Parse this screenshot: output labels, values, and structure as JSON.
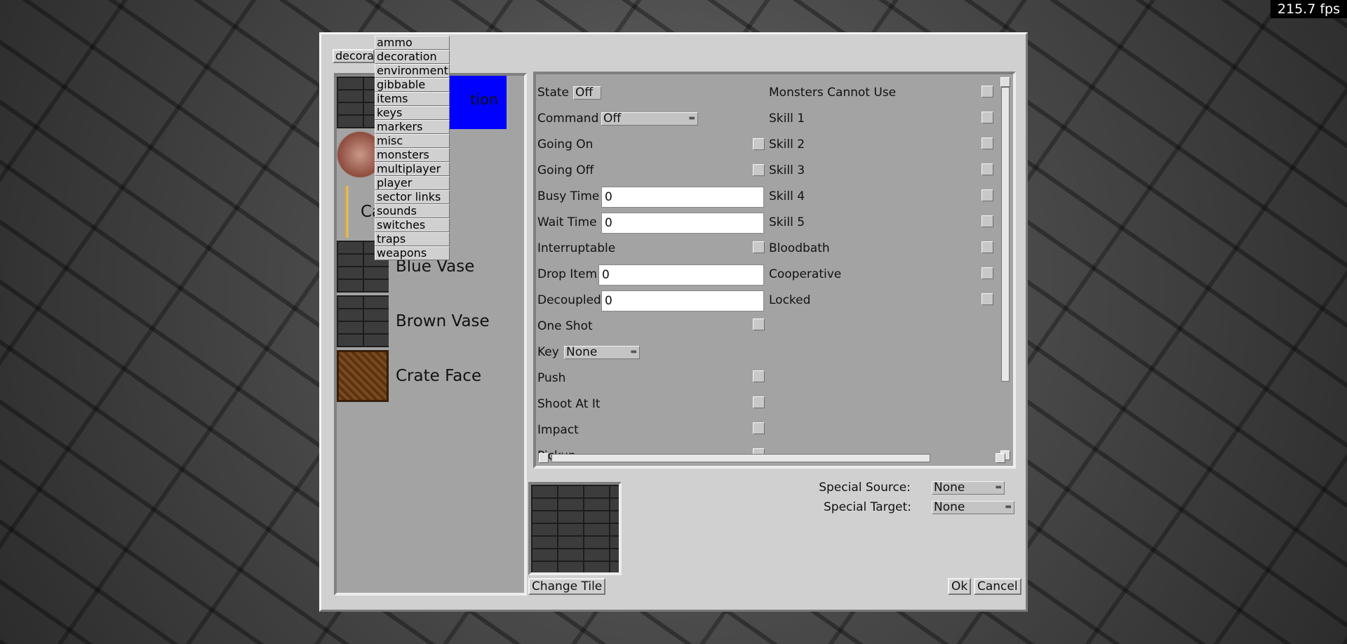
{
  "fps": "215.7 fps",
  "category": {
    "current": "decoration",
    "options": [
      "ammo",
      "decoration",
      "environment",
      "gibbable",
      "items",
      "keys",
      "markers",
      "misc",
      "monsters",
      "multiplayer",
      "player",
      "sector links",
      "sounds",
      "switches",
      "traps",
      "weapons"
    ]
  },
  "tiles": {
    "selected_partial_label": "tion",
    "candle_partial_label": "Ca",
    "items": [
      {
        "label": "Blue Vase"
      },
      {
        "label": "Brown Vase"
      },
      {
        "label": "Crate Face"
      }
    ]
  },
  "props_left": {
    "state": {
      "label": "State",
      "value": "Off"
    },
    "command": {
      "label": "Command",
      "value": "Off"
    },
    "going_on": "Going On",
    "going_off": "Going Off",
    "busy_time": {
      "label": "Busy Time",
      "value": "0"
    },
    "wait_time": {
      "label": "Wait Time",
      "value": "0"
    },
    "interruptable": "Interruptable",
    "drop_item": {
      "label": "Drop Item",
      "value": "0"
    },
    "decoupled": {
      "label": "Decoupled",
      "value": "0"
    },
    "one_shot": "One Shot",
    "key": {
      "label": "Key",
      "value": "None"
    },
    "push": "Push",
    "shoot_at_it": "Shoot At It",
    "impact": "Impact",
    "pickup": "Pickup"
  },
  "props_right": [
    "Monsters Cannot Use",
    "Skill 1",
    "Skill 2",
    "Skill 3",
    "Skill 4",
    "Skill 5",
    "Bloodbath",
    "Cooperative",
    "Locked"
  ],
  "special": {
    "source_label": "Special Source:",
    "source_value": "None",
    "target_label": "Special Target:",
    "target_value": "None"
  },
  "buttons": {
    "change_tile": "Change Tile",
    "ok": "Ok",
    "cancel": "Cancel"
  }
}
